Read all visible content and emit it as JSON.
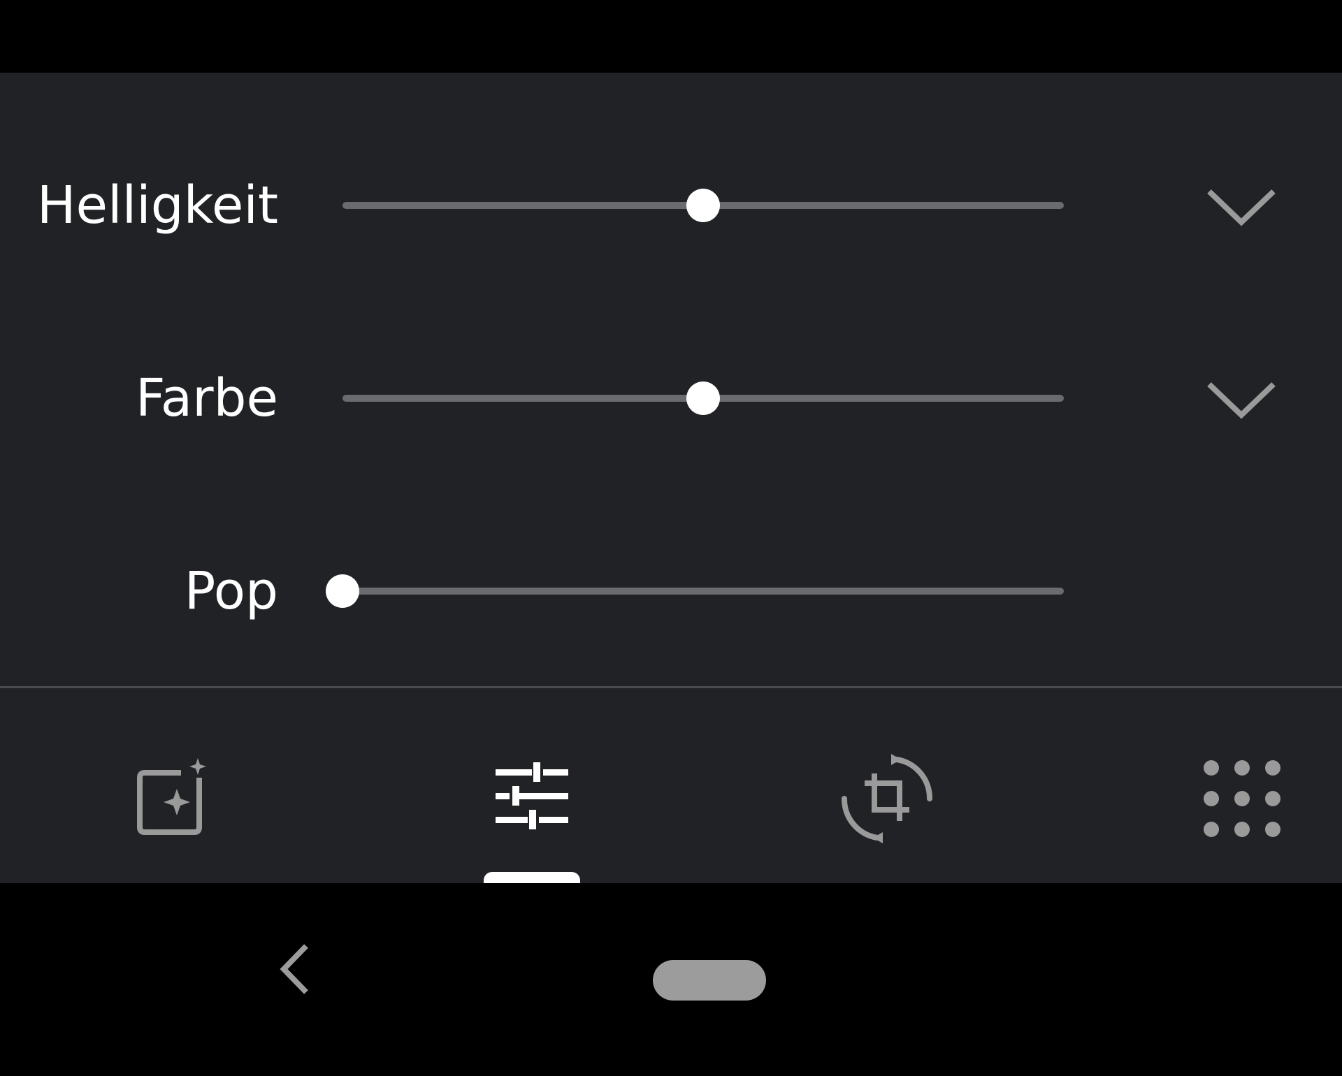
{
  "adjustments": [
    {
      "label": "Helligkeit",
      "value": 0.5,
      "expandable": true,
      "expand_icon": "chevron-down-icon"
    },
    {
      "label": "Farbe",
      "value": 0.5,
      "expandable": true,
      "expand_icon": "chevron-down-icon"
    },
    {
      "label": "Pop",
      "value": 0.0,
      "expandable": false
    }
  ],
  "tools": [
    {
      "id": "suggestions",
      "icon": "photo-sparkle-icon",
      "active": false
    },
    {
      "id": "adjust",
      "icon": "sliders-icon",
      "active": true
    },
    {
      "id": "crop-rotate",
      "icon": "crop-rotate-icon",
      "active": false
    },
    {
      "id": "more-tools",
      "icon": "grid-dots-icon",
      "active": false
    }
  ],
  "nav": {
    "back_icon": "back-chevron-icon",
    "home_icon": "home-pill"
  },
  "colors": {
    "panel_background": "#212226",
    "screen_background": "#000000",
    "label_text": "#ffffff",
    "slider_track": "#6a6b6f",
    "slider_thumb": "#ffffff",
    "icon_inactive": "#9a9a9a",
    "icon_active": "#ffffff",
    "divider": "#4a4b50",
    "home_pill": "#9c9c9c"
  }
}
